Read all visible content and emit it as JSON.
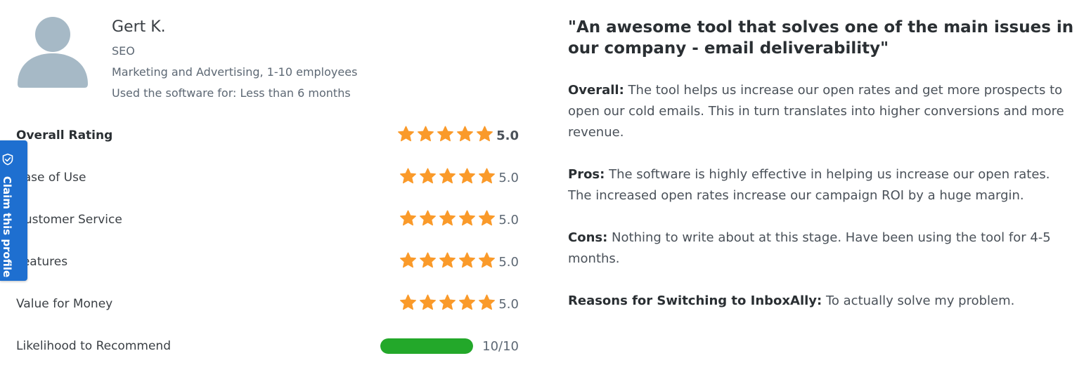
{
  "reviewer": {
    "name": "Gert K.",
    "title": "SEO",
    "industry": "Marketing and Advertising, 1-10 employees",
    "usage": "Used the software for: Less than 6 months",
    "avatar_icon": "user-avatar-icon"
  },
  "ratings": {
    "star_color": "#fa9a2a",
    "items": [
      {
        "label": "Overall Rating",
        "value": "5.0",
        "stars": 5
      },
      {
        "label": "Ease of Use",
        "value": "5.0",
        "stars": 5
      },
      {
        "label": "Customer Service",
        "value": "5.0",
        "stars": 5
      },
      {
        "label": "Features",
        "value": "5.0",
        "stars": 5
      },
      {
        "label": "Value for Money",
        "value": "5.0",
        "stars": 5
      }
    ],
    "recommend": {
      "label": "Likelihood to Recommend",
      "value": "10/10",
      "fraction": 1.0,
      "bar_color": "#23a82a"
    }
  },
  "claim_tab": {
    "label": "Claim this profile",
    "icon": "shield-check-icon",
    "color": "#1e6fd0"
  },
  "review": {
    "title": "\"An awesome tool that solves one of the main issues in our company - email deliverability\"",
    "overall_label": "Overall:",
    "overall_text": "The tool helps us increase our open rates and get more prospects to open our cold emails. This in turn translates into higher conversions and more revenue.",
    "pros_label": "Pros:",
    "pros_text": "The software is highly effective in helping us increase our open rates. The increased open rates increase our campaign ROI by a huge margin.",
    "cons_label": "Cons:",
    "cons_text": "Nothing to write about at this stage. Have been using the tool for 4-5 months.",
    "switch_label": "Reasons for Switching to InboxAlly:",
    "switch_text": "To actually solve my problem."
  }
}
